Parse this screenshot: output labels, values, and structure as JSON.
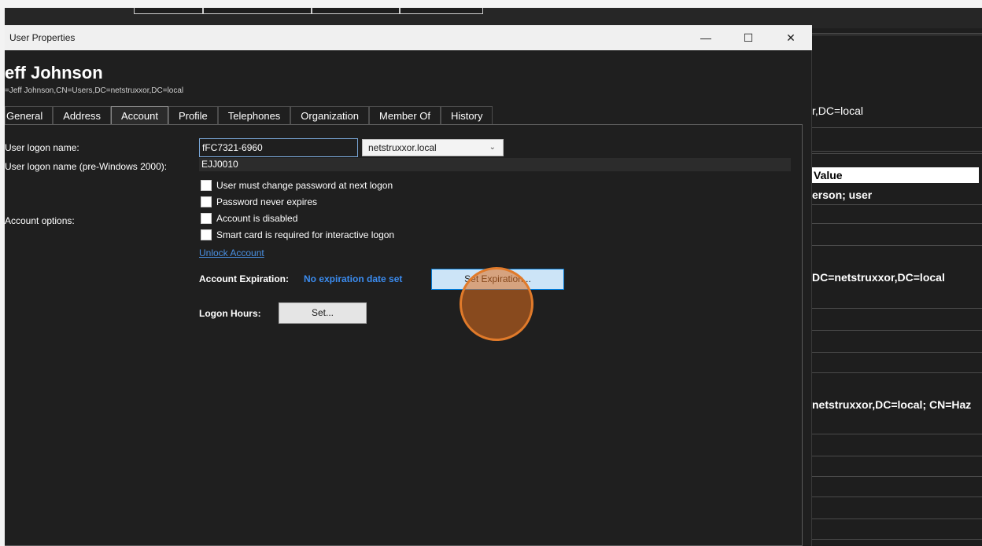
{
  "dialog": {
    "title": "User Properties",
    "user_name": "eff Johnson",
    "dn": "=Jeff Johnson,CN=Users,DC=netstruxxor,DC=local",
    "window_controls": {
      "minimize": "—",
      "maximize": "☐",
      "close": "✕"
    }
  },
  "tabs": [
    "General",
    "Address",
    "Account",
    "Profile",
    "Telephones",
    "Organization",
    "Member Of",
    "History"
  ],
  "active_tab": "Account",
  "account": {
    "logon_name_label": "User logon name:",
    "logon_name_value": "fFC7321-6960",
    "domain_value": "netstruxxor.local",
    "pre2000_label": "User logon name (pre-Windows 2000):",
    "pre2000_value": "EJJ0010",
    "account_options_label": "Account options:",
    "options": [
      "User must change password at next logon",
      "Password never expires",
      "Account is disabled",
      "Smart card is required for interactive logon"
    ],
    "unlock_link": "Unlock Account",
    "expiration_label": "Account Expiration:",
    "expiration_status": "No expiration date set",
    "set_expiration_button": "Set Expiration...",
    "logon_hours_label": "Logon Hours:",
    "set_button": "Set..."
  },
  "background": {
    "dn_fragment": "r,DC=local",
    "value_header": "Value",
    "object_class": "erson; user",
    "dc_fragment": "DC=netstruxxor,DC=local",
    "member_fragment": "netstruxxor,DC=local; CN=Haz"
  },
  "colors": {
    "accent_link": "#4a90e2",
    "status_blue": "#3b8cf0",
    "button_highlight": "#cce4f7",
    "click_indicator": "#e07a2a"
  }
}
